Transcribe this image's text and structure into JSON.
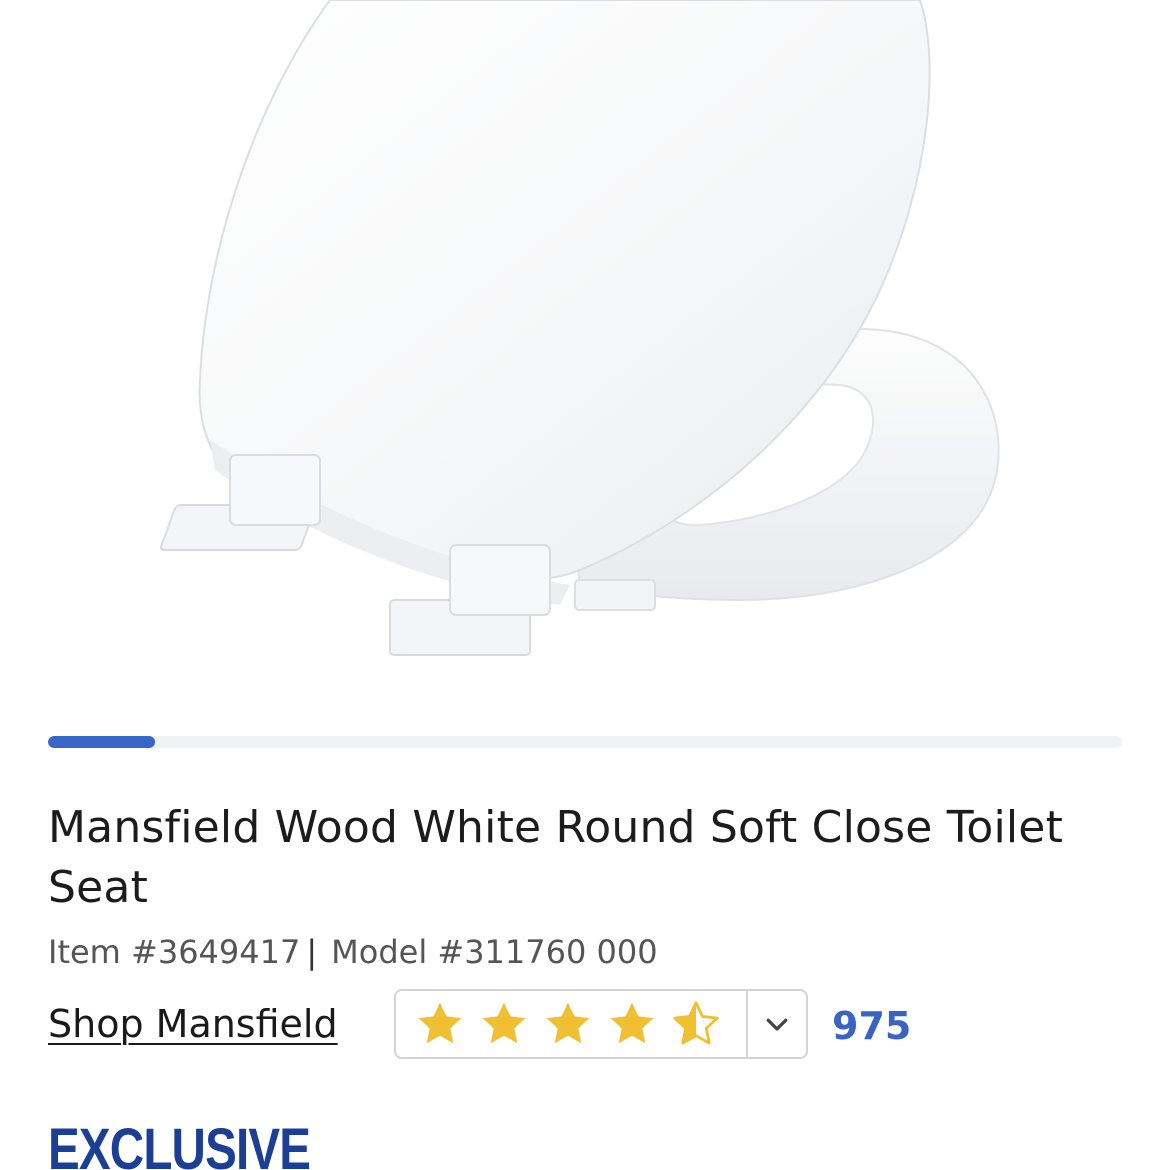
{
  "product": {
    "image_alt": "toilet seat product image",
    "title": "Mansfield Wood White Round Soft Close Toilet Seat",
    "item_number": "Item #3649417",
    "model_number": "Model #311760 000",
    "separator": "|",
    "brand_link": "Shop Mansfield",
    "badge": "EXCLUSIVE"
  },
  "carousel": {
    "progress_fraction": 0.1
  },
  "rating": {
    "value": 4.5,
    "max": 5,
    "review_count": "975",
    "star_icon": "star-icon",
    "half_star_icon": "half-star-icon",
    "expand_icon": "chevron-down-icon"
  },
  "colors": {
    "accent_blue": "#3667c8",
    "link_blue": "#3a64c4",
    "star_gold": "#f0c030",
    "badge_navy": "#1b3f95"
  }
}
